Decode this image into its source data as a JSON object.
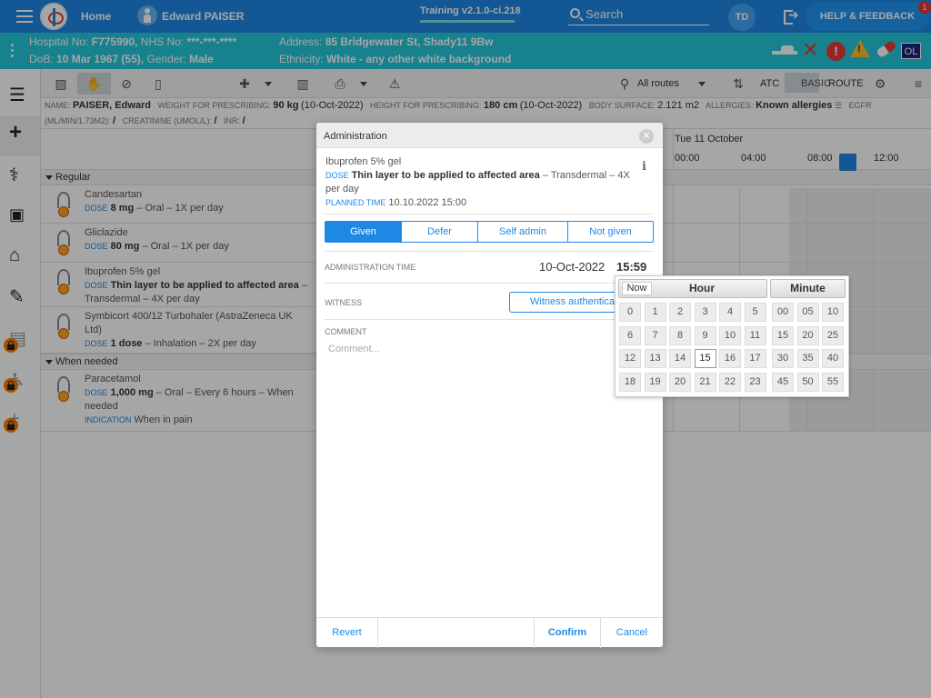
{
  "topbar": {
    "home": "Home",
    "patient_name": "Edward PAISER",
    "training": "Training v2.1.0-ci.218",
    "search": "Search",
    "user_initials": "TD",
    "help": "HELP & FEEDBACK",
    "help_badge": "1"
  },
  "banner": {
    "hospital_label": "Hospital No:",
    "hospital_no": "F775990,",
    "nhs_label": "NHS No:",
    "nhs_no": "***-***-****",
    "dob_label": "DoB:",
    "dob": "10 Mar 1967 (55),",
    "gender_label": "Gender:",
    "gender": "Male",
    "address_label": "Address:",
    "address": "85 Bridgewater St, Shady11 9Bw",
    "ethnicity_label": "Ethnicity:",
    "ethnicity": "White - any other white background",
    "ol": "OL"
  },
  "toolbar": {
    "routes": "All routes",
    "atc": "ATC",
    "basic": "BASIC",
    "route": "ROUTE"
  },
  "info": {
    "name_label": "NAME:",
    "name": "PAISER, Edward",
    "weight_label": "WEIGHT FOR PRESCRIBING:",
    "weight": "90 kg",
    "weight_date": "(10-Oct-2022)",
    "height_label": "HEIGHT FOR PRESCRIBING:",
    "height": "180 cm",
    "height_date": "(10-Oct-2022)",
    "body_label": "BODY SURFACE:",
    "body": "2.121 m2",
    "allergies_label": "ALLERGIES:",
    "allergies": "Known allergies",
    "egfr_label": "EGFR",
    "egfr_unit": "(ML/MIN/1.73M2):",
    "egfr_val": "/",
    "creat_label": "CREATININE (UMOL/L):",
    "creat_val": "/",
    "inr_label": "INR:",
    "inr_val": "/"
  },
  "timeline": {
    "date": "Tue 11 October",
    "hours": [
      "00:00",
      "04:00",
      "08:00",
      "12:00"
    ]
  },
  "sections": {
    "regular": "Regular",
    "when_needed": "When needed"
  },
  "drugs": [
    {
      "name": "Candesartan",
      "dose_label": "DOSE",
      "dose": "8 mg",
      "detail": "– Oral – 1X per day"
    },
    {
      "name": "Gliclazide",
      "dose_label": "DOSE",
      "dose": "80 mg",
      "detail": "– Oral – 1X per day"
    },
    {
      "name": "Ibuprofen 5% gel",
      "dose_label": "DOSE",
      "dose": "Thin layer to be applied to affected area",
      "detail": "– Transdermal – 4X per day"
    },
    {
      "name": "Symbicort 400/12 Turbohaler (AstraZeneca UK Ltd)",
      "dose_label": "DOSE",
      "dose": "1 dose",
      "detail": "– Inhalation – 2X per day"
    },
    {
      "name": "Paracetamol",
      "dose_label": "DOSE",
      "dose": "1,000 mg",
      "detail": "– Oral – Every 6 hours – When needed",
      "indication_label": "INDICATION",
      "indication": "When in pain"
    }
  ],
  "modal": {
    "title": "Administration",
    "drug": "Ibuprofen 5% gel",
    "dose_label": "DOSE",
    "dose": "Thin layer to be applied to affected area",
    "dose_detail": "– Transdermal – 4X per day",
    "planned_label": "PLANNED TIME",
    "planned": "10.10.2022 15:00",
    "tabs": [
      "Given",
      "Defer",
      "Self admin",
      "Not given"
    ],
    "admin_time_label": "ADMINISTRATION TIME",
    "admin_date": "10-Oct-2022",
    "admin_time": "15:59",
    "witness_label": "WITNESS",
    "witness_btn": "Witness authentication",
    "comment_label": "COMMENT",
    "comment_placeholder": "Comment...",
    "revert": "Revert",
    "confirm": "Confirm",
    "cancel": "Cancel"
  },
  "picker": {
    "now": "Now",
    "hour": "Hour",
    "minute": "Minute",
    "hours": [
      "0",
      "1",
      "2",
      "3",
      "4",
      "5",
      "6",
      "7",
      "8",
      "9",
      "10",
      "11",
      "12",
      "13",
      "14",
      "15",
      "16",
      "17",
      "18",
      "19",
      "20",
      "21",
      "22",
      "23"
    ],
    "minutes": [
      "00",
      "05",
      "10",
      "15",
      "20",
      "25",
      "30",
      "35",
      "40",
      "45",
      "50",
      "55"
    ],
    "selected_hour": "15"
  }
}
